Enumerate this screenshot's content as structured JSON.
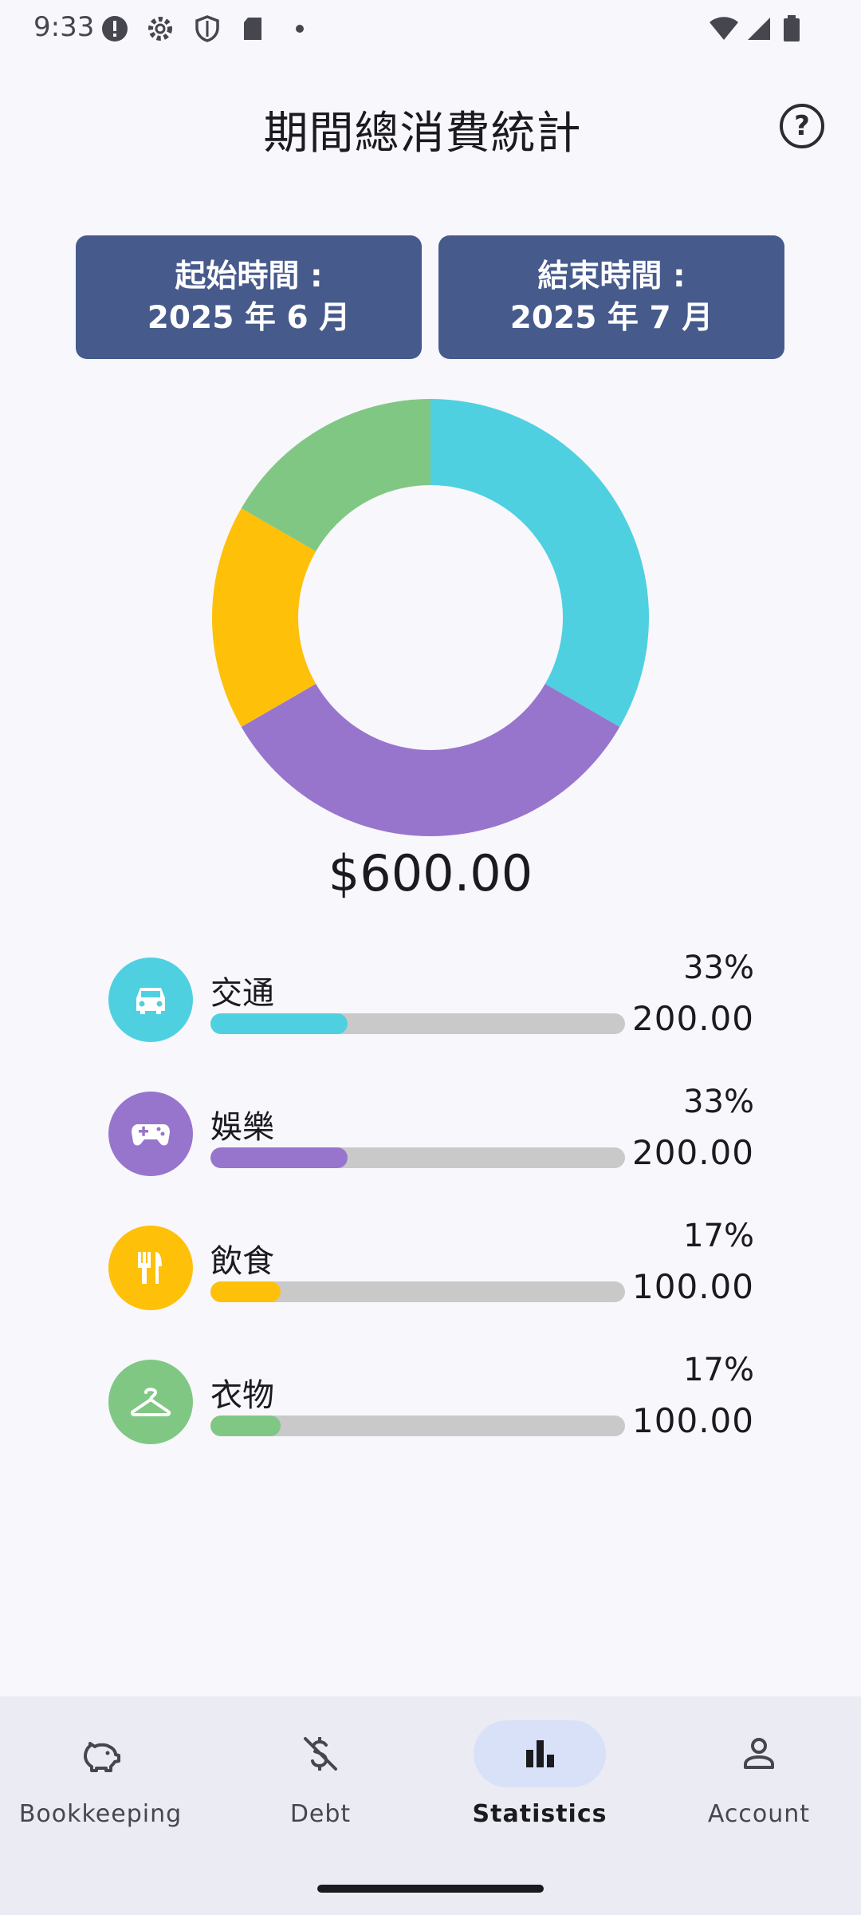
{
  "status_bar": {
    "time": "9:33"
  },
  "header": {
    "title": "期間總消費統計",
    "help_icon": "help-circle-icon"
  },
  "date_range": {
    "start_label": "起始時間 :",
    "start_value": "2025 年 6 月",
    "end_label": "結束時間 :",
    "end_value": "2025 年 7 月"
  },
  "chart_data": {
    "type": "pie",
    "categories": [
      "交通",
      "娛樂",
      "飲食",
      "衣物"
    ],
    "values": [
      200,
      200,
      100,
      100
    ],
    "colors": [
      "#4fd0e1",
      "#9775cd",
      "#fec009",
      "#81c784"
    ]
  },
  "summary": {
    "total": "$600.00"
  },
  "categories": [
    {
      "name": "交通",
      "percent": "33%",
      "amount": "200.00",
      "fraction": 0.33,
      "color": "#4fd0e1",
      "icon": "car-icon"
    },
    {
      "name": "娛樂",
      "percent": "33%",
      "amount": "200.00",
      "fraction": 0.33,
      "color": "#9775cd",
      "icon": "gamepad-icon"
    },
    {
      "name": "飲食",
      "percent": "17%",
      "amount": "100.00",
      "fraction": 0.17,
      "color": "#fec009",
      "icon": "utensils-icon"
    },
    {
      "name": "衣物",
      "percent": "17%",
      "amount": "100.00",
      "fraction": 0.17,
      "color": "#81c784",
      "icon": "hanger-icon"
    }
  ],
  "nav": {
    "items": [
      {
        "label": "Bookkeeping",
        "icon": "piggy-bank-icon",
        "active": false
      },
      {
        "label": "Debt",
        "icon": "money-off-icon",
        "active": false
      },
      {
        "label": "Statistics",
        "icon": "bar-chart-icon",
        "active": true
      },
      {
        "label": "Account",
        "icon": "person-icon",
        "active": false
      }
    ]
  }
}
